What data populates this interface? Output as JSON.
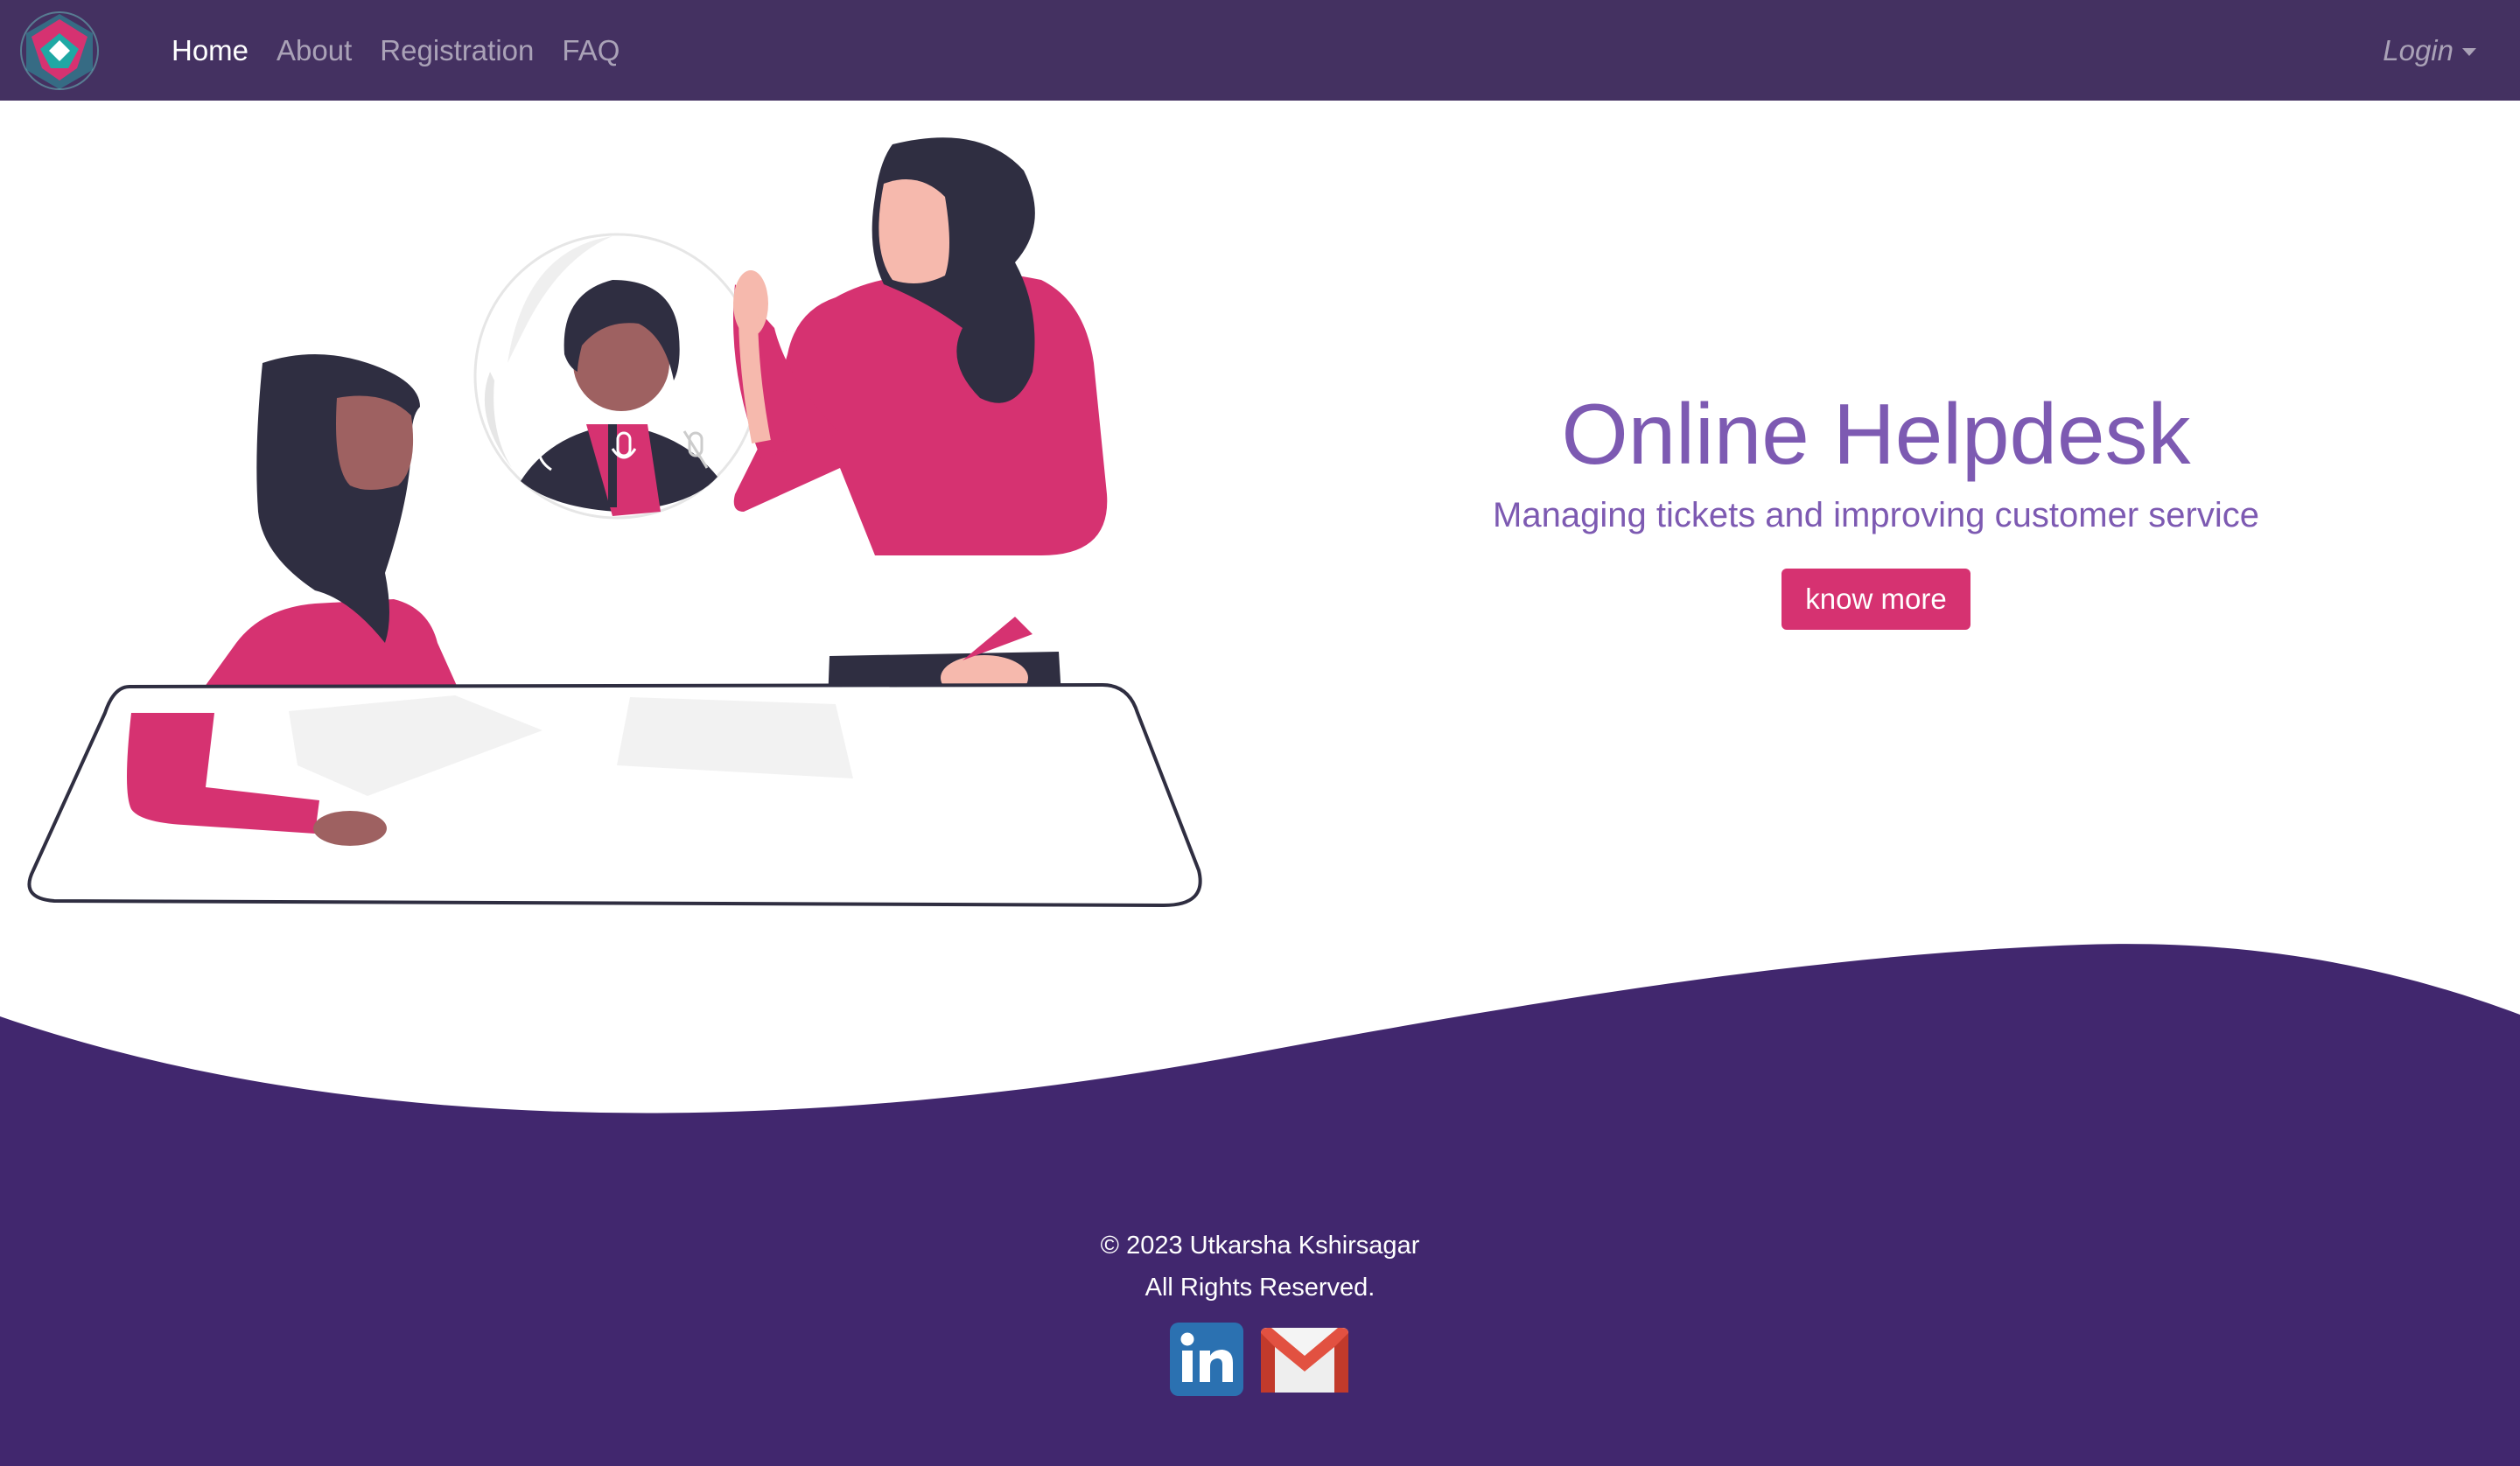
{
  "nav": {
    "brand_icon": "helpdesk-logo-icon",
    "links": [
      {
        "label": "Home",
        "active": true
      },
      {
        "label": "About",
        "active": false
      },
      {
        "label": "Registration",
        "active": false
      },
      {
        "label": "FAQ",
        "active": false
      }
    ],
    "login_label": "Login"
  },
  "hero": {
    "title": "Online Helpdesk",
    "subtitle": "Managing tickets and improving customer service",
    "button_label": "know more",
    "illustration_icon": "video-meeting-illustration"
  },
  "footer": {
    "copyright": "© 2023 Utkarsha Kshirsagar",
    "rights": "All Rights Reserved.",
    "social": [
      {
        "icon": "linkedin-icon"
      },
      {
        "icon": "gmail-icon"
      }
    ]
  },
  "colors": {
    "navbar": "#443161",
    "footer": "#41276e",
    "accent": "#d63271",
    "title": "#7d5ab2"
  }
}
